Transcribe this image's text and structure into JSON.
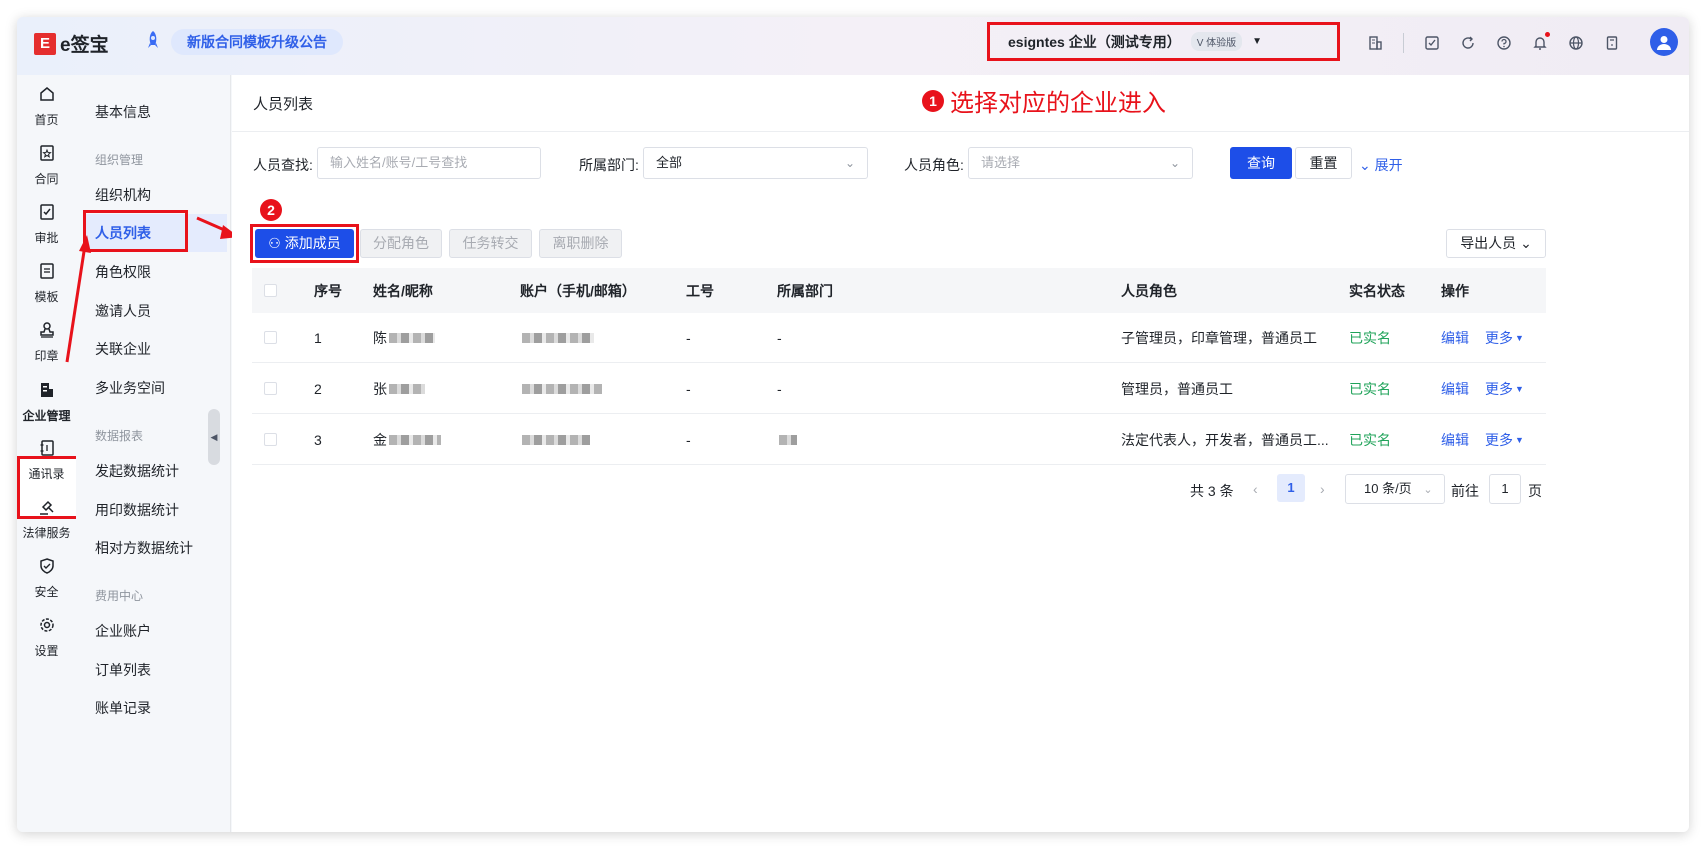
{
  "header": {
    "logo_mark": "E",
    "logo_text": "e签宝",
    "announcement": "新版合同模板升级公告",
    "org_name": "esigntes      企业（测试专用）",
    "org_badge": "V 体验版",
    "icons": [
      "building-icon",
      "task-icon",
      "refresh-icon",
      "help-icon",
      "bell-icon",
      "globe-icon",
      "calculator-icon"
    ]
  },
  "rail": {
    "items": [
      {
        "label": "首页",
        "icon": "home-icon"
      },
      {
        "label": "合同",
        "icon": "contract-icon"
      },
      {
        "label": "审批",
        "icon": "approve-icon"
      },
      {
        "label": "模板",
        "icon": "template-icon"
      },
      {
        "label": "印章",
        "icon": "seal-icon"
      },
      {
        "label": "企业管理",
        "icon": "enterprise-icon"
      },
      {
        "label": "通讯录",
        "icon": "contacts-icon"
      },
      {
        "label": "法律服务",
        "icon": "legal-icon"
      },
      {
        "label": "安全",
        "icon": "shield-icon"
      },
      {
        "label": "设置",
        "icon": "settings-icon"
      }
    ]
  },
  "subnav": {
    "basic": "基本信息",
    "group_org": "组织管理",
    "org_structure": "组织机构",
    "member_list": "人员列表",
    "role_perm": "角色权限",
    "invite": "邀请人员",
    "related": "关联企业",
    "multi_space": "多业务空间",
    "group_report": "数据报表",
    "stat_initiate": "发起数据统计",
    "stat_seal": "用印数据统计",
    "stat_counter": "相对方数据统计",
    "group_fee": "费用中心",
    "account": "企业账户",
    "orders": "订单列表",
    "bills": "账单记录"
  },
  "main": {
    "title": "人员列表",
    "step1_num": "1",
    "step1_text": "选择对应的企业进入",
    "step2_num": "2",
    "filters": {
      "search_label": "人员查找:",
      "search_placeholder": "输入姓名/账号/工号查找",
      "dept_label": "所属部门:",
      "dept_value": "全部",
      "role_label": "人员角色:",
      "role_placeholder": "请选择",
      "query": "查询",
      "reset": "重置",
      "expand": "展开"
    },
    "actions": {
      "add": "添加成员",
      "assign_role": "分配角色",
      "transfer": "任务转交",
      "resign": "离职删除",
      "export": "导出人员"
    },
    "table": {
      "headers": [
        "序号",
        "姓名/昵称",
        "账户（手机/邮箱）",
        "工号",
        "所属部门",
        "人员角色",
        "实名状态",
        "操作"
      ],
      "rows": [
        {
          "no": "1",
          "name": "陈",
          "job_no": "-",
          "dept": "-",
          "roles": "子管理员，印章管理，普通员工",
          "status": "已实名",
          "edit": "编辑",
          "more": "更多"
        },
        {
          "no": "2",
          "name": "张",
          "job_no": "-",
          "dept": "-",
          "roles": "管理员，普通员工",
          "status": "已实名",
          "edit": "编辑",
          "more": "更多"
        },
        {
          "no": "3",
          "name": "金",
          "job_no": "-",
          "dept": "",
          "roles": "法定代表人，开发者，普通员工...",
          "status": "已实名",
          "edit": "编辑",
          "more": "更多"
        }
      ]
    },
    "pagination": {
      "total": "共 3 条",
      "current": "1",
      "page_size": "10 条/页",
      "goto_label": "前往",
      "goto_value": "1",
      "page_unit": "页"
    }
  }
}
